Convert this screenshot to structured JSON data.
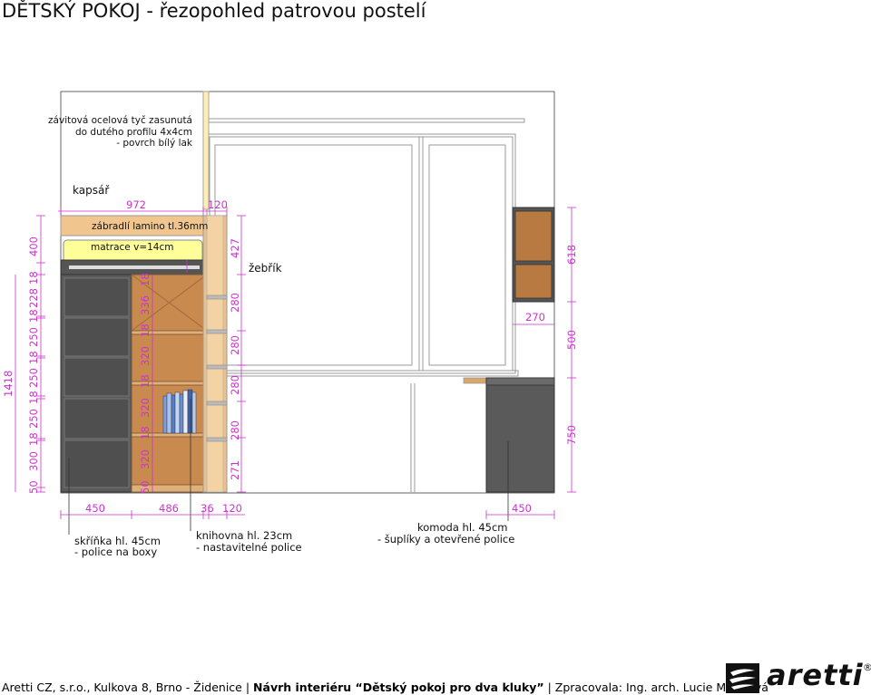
{
  "title": "DĚTSKÝ POKOJ - řezopohled patrovou postelí",
  "notes": {
    "rod_line1": "závitová ocelová tyč zasunutá",
    "rod_line2": "do dutého profilu 4x4cm",
    "rod_line3": "- povrch bílý lak",
    "kapsar": "kapsář",
    "railing": "zábradlí lamino tl.36mm",
    "mattress": "matrace v=14cm",
    "ladder": "žebřík",
    "wardrobe_line1": "skříňka hl. 45cm",
    "wardrobe_line2": "- police na boxy",
    "bookcase_line1": "knihovna hl. 23cm",
    "bookcase_line2": "- nastavitelné police",
    "dresser_line1": "komoda  hl. 45cm",
    "dresser_line2": "- šuplíky a otevřené police"
  },
  "dimensions": {
    "top_972": "972",
    "top_120": "120",
    "left_total": "1418",
    "left_chain": [
      "400",
      "18",
      "228",
      "18",
      "250",
      "18",
      "250",
      "18",
      "250",
      "18",
      "300",
      "50"
    ],
    "shelf_chain": [
      "18",
      "336",
      "18",
      "320",
      "18",
      "320",
      "18",
      "320",
      "50"
    ],
    "ladder_chain": [
      "427",
      "280",
      "280",
      "280",
      "280",
      "271"
    ],
    "right_chain": [
      "618",
      "500",
      "750"
    ],
    "shelf_width": "270",
    "bottom_450": "450",
    "bottom_486": "486",
    "bottom_36": "36",
    "bottom_120": "120",
    "bottom_right_450": "450"
  },
  "footer": {
    "prefix": "Aretti CZ, s.r.o.,  Kulkova 8, Brno - Židenice | ",
    "bold": "Návrh interiéru “Dětský pokoj pro dva kluky”",
    "suffix": " | Zpracovala: Ing. arch. Lucie Matulová"
  },
  "logo": {
    "text": "aretti",
    "reg": "®"
  },
  "colors": {
    "dimension": "#cc33cc",
    "wood": "#d9a66b",
    "wood_dark": "#b87333",
    "dark_gray": "#555555",
    "mattress": "#ffff99"
  }
}
